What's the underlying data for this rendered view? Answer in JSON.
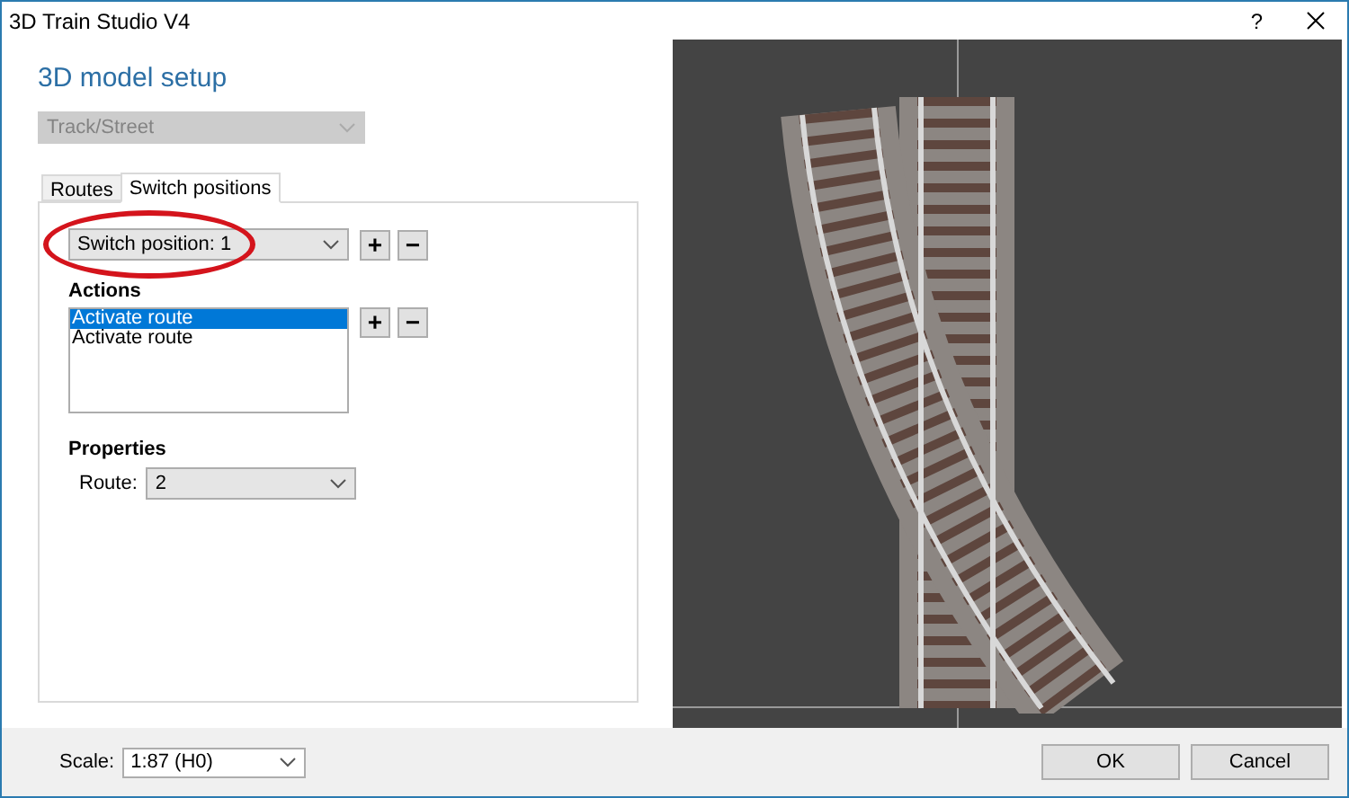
{
  "window": {
    "title": "3D Train Studio V4",
    "help": "?"
  },
  "heading": "3D model setup",
  "model_type": {
    "value": "Track/Street",
    "disabled": true
  },
  "tabs": [
    {
      "label": "Routes",
      "selected": false
    },
    {
      "label": "Switch positions",
      "selected": true
    }
  ],
  "switch_position": {
    "value": "Switch position: 1",
    "add": "+",
    "remove": "−",
    "highlighted": true
  },
  "actions": {
    "label": "Actions",
    "add": "+",
    "remove": "−",
    "items": [
      {
        "label": "Activate route",
        "selected": true
      },
      {
        "label": "Activate route",
        "selected": false
      }
    ]
  },
  "properties": {
    "label": "Properties",
    "route_label": "Route:",
    "route_value": "2"
  },
  "scale": {
    "label": "Scale:",
    "value": "1:87 (H0)"
  },
  "buttons": [
    "OK",
    "Cancel"
  ]
}
